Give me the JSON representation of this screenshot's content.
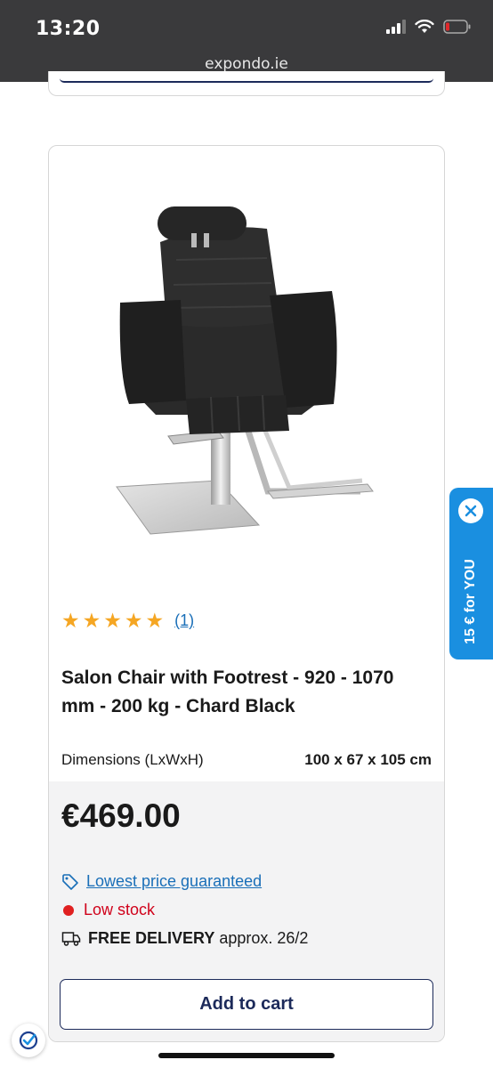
{
  "status_bar": {
    "time": "13:20",
    "url": "expondo.ie"
  },
  "product": {
    "rating_count": "(1)",
    "stars": 5,
    "title": "Salon Chair with Footrest - 920 - 1070 mm - 200 kg - Chard Black",
    "dimensions_label": "Dimensions (LxWxH)",
    "dimensions_value": "100 x 67 x 105 cm",
    "price": "€469.00",
    "lowest_price": "Lowest price guaranteed",
    "stock": "Low stock",
    "delivery_strong": "FREE DELIVERY",
    "delivery_rest": " approx. 26/2",
    "add_to_cart": "Add to cart"
  },
  "promo": {
    "label": "15 € for YOU"
  },
  "icons": [
    "signal-icon",
    "wifi-icon",
    "battery-icon",
    "star-icon",
    "tag-icon",
    "truck-icon",
    "close-icon",
    "shield-check-icon"
  ],
  "colors": {
    "accent_blue": "#1a8fe0",
    "navy": "#1c2a5a",
    "star": "#f5a623",
    "low_stock": "#d0021b",
    "link": "#1a6fb8"
  }
}
